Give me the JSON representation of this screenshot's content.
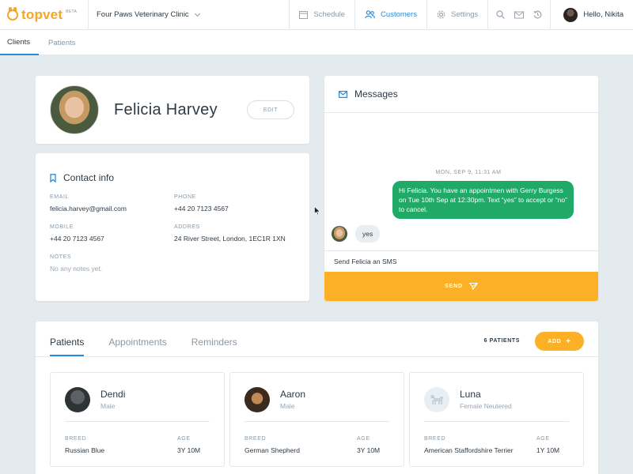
{
  "brand": {
    "name": "topvet",
    "badge": "BETA",
    "accent": "#f5a623"
  },
  "clinic": {
    "name": "Four Paws Veterinary Clinic"
  },
  "nav": {
    "items": [
      {
        "label": "Schedule",
        "icon": "calendar-icon",
        "active": false
      },
      {
        "label": "Customers",
        "icon": "users-icon",
        "active": true
      },
      {
        "label": "Settings",
        "icon": "gear-icon",
        "active": false
      }
    ],
    "utility_icons": [
      "search-icon",
      "mail-icon",
      "history-icon"
    ],
    "greeting": "Hello, Nikita"
  },
  "subnav": {
    "tabs": [
      {
        "label": "Clients",
        "active": true
      },
      {
        "label": "Patients",
        "active": false
      }
    ]
  },
  "client": {
    "name": "Felicia Harvey",
    "edit_label": "EDIT"
  },
  "contact": {
    "title": "Contact info",
    "email_label": "EMAIL",
    "email": "felicia.harvey@gmail.com",
    "phone_label": "PHONE",
    "phone": "+44 20 7123 4567",
    "mobile_label": "MOBILE",
    "mobile": "+44 20 7123 4567",
    "address_label": "ADDRES",
    "address": "24 River Street, London, 1EC1R 1XN",
    "notes_label": "NOTES",
    "notes": "No any notes yet."
  },
  "messages": {
    "title": "Messages",
    "date": "MON, SEP 9, 11:31 AM",
    "outgoing": "Hi Felicia. You have an appointmen with Gerry Burgess on Tue 10th Sep at 12:30pm. Text “yes” to accept or “no” to cancel.",
    "incoming": "yes",
    "input_placeholder": "Send Felicia an SMS",
    "send_label": "SEND"
  },
  "patients": {
    "tabs": [
      {
        "label": "Patients",
        "active": true
      },
      {
        "label": "Appointments",
        "active": false
      },
      {
        "label": "Reminders",
        "active": false
      }
    ],
    "count_label": "6 PATIENTS",
    "add_label": "ADD",
    "breed_label": "BREED",
    "age_label": "AGE",
    "cards": [
      {
        "name": "Dendi",
        "sub": "Male",
        "breed": "Russian Blue",
        "age": "3Y 10M"
      },
      {
        "name": "Aaron",
        "sub": "Male",
        "breed": "German Shepherd",
        "age": "3Y 10M"
      },
      {
        "name": "Luna",
        "sub": "Female Neutered",
        "breed": "American Staffordshire Terrier",
        "age": "1Y 10M"
      }
    ]
  },
  "colors": {
    "primary_blue": "#2a8ad6",
    "send_orange": "#fbb026",
    "bubble_green": "#1faa67",
    "background": "#e4ebef"
  }
}
